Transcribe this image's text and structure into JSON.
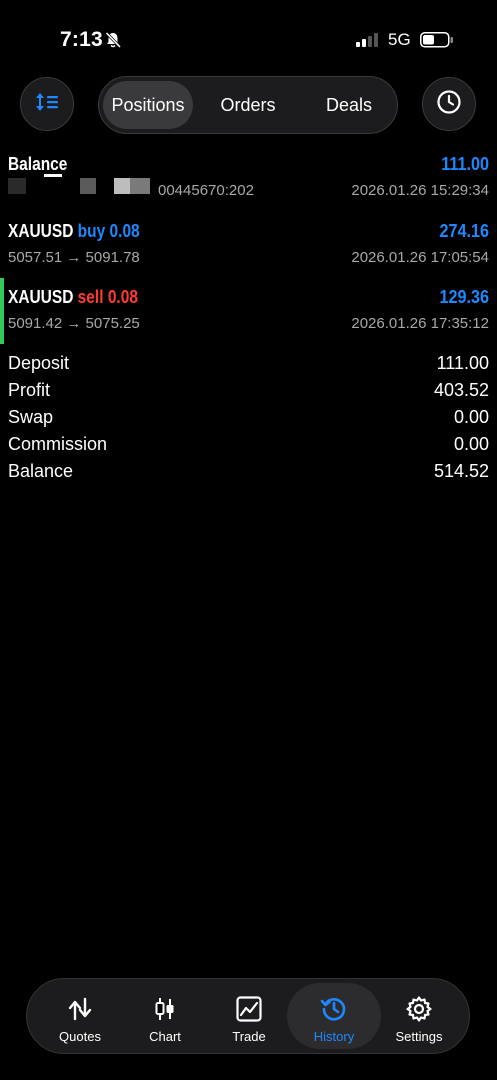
{
  "status": {
    "time": "7:13",
    "network": "5G"
  },
  "segments": [
    "Positions",
    "Orders",
    "Deals"
  ],
  "active_segment": "Positions",
  "deals": {
    "balance": {
      "title": "Balance",
      "amount": "111.00",
      "id_fragment": "00445670:202",
      "date": "2026.01.26 15:29:34"
    },
    "trade1": {
      "symbol": "XAUUSD",
      "side": "buy",
      "volume": "0.08",
      "profit": "274.16",
      "prices": "5057.51 → 5091.78",
      "date": "2026.01.26 17:05:54"
    },
    "trade2": {
      "symbol": "XAUUSD",
      "side": "sell",
      "volume": "0.08",
      "profit": "129.36",
      "prices": "5091.42 → 5075.25",
      "date": "2026.01.26 17:35:12"
    }
  },
  "summary": [
    {
      "label": "Deposit",
      "value": "111.00"
    },
    {
      "label": "Profit",
      "value": "403.52"
    },
    {
      "label": "Swap",
      "value": "0.00"
    },
    {
      "label": "Commission",
      "value": "0.00"
    },
    {
      "label": "Balance",
      "value": "514.52"
    }
  ],
  "tabs": [
    "Quotes",
    "Chart",
    "Trade",
    "History",
    "Settings"
  ],
  "active_tab": "History",
  "colors": {
    "accent": "#1e88ff",
    "sell": "#ff3b30",
    "buy": "#1e88ff",
    "marker": "#34c759"
  }
}
